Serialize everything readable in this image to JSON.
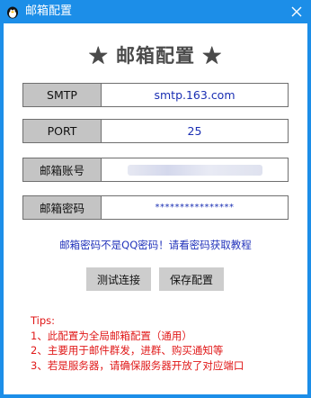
{
  "window": {
    "title": "邮箱配置",
    "icons": {
      "app": "penguin-icon",
      "close": "close-icon"
    },
    "colors": {
      "titlebar": "#1c8ee8",
      "label_bg": "#c4c4c4",
      "value_text": "#1a2fb3",
      "notice_text": "#2233bb",
      "tips_text": "#e01818"
    }
  },
  "heading": "★  邮箱配置  ★",
  "fields": [
    {
      "label": "SMTP",
      "value": "smtp.163.com"
    },
    {
      "label": "PORT",
      "value": "25"
    },
    {
      "label": "邮箱账号",
      "value": ""
    },
    {
      "label": "邮箱密码",
      "value": "****************"
    }
  ],
  "notice": "邮箱密码不是QQ密码！请看密码获取教程",
  "buttons": {
    "test": "测试连接",
    "save": "保存配置"
  },
  "tips": {
    "title": "Tips:",
    "lines": [
      "1、此配置为全局邮箱配置（通用）",
      "2、主要用于邮件群发，进群、购买通知等",
      "3、若是服务器，请确保服务器开放了对应端口"
    ]
  }
}
